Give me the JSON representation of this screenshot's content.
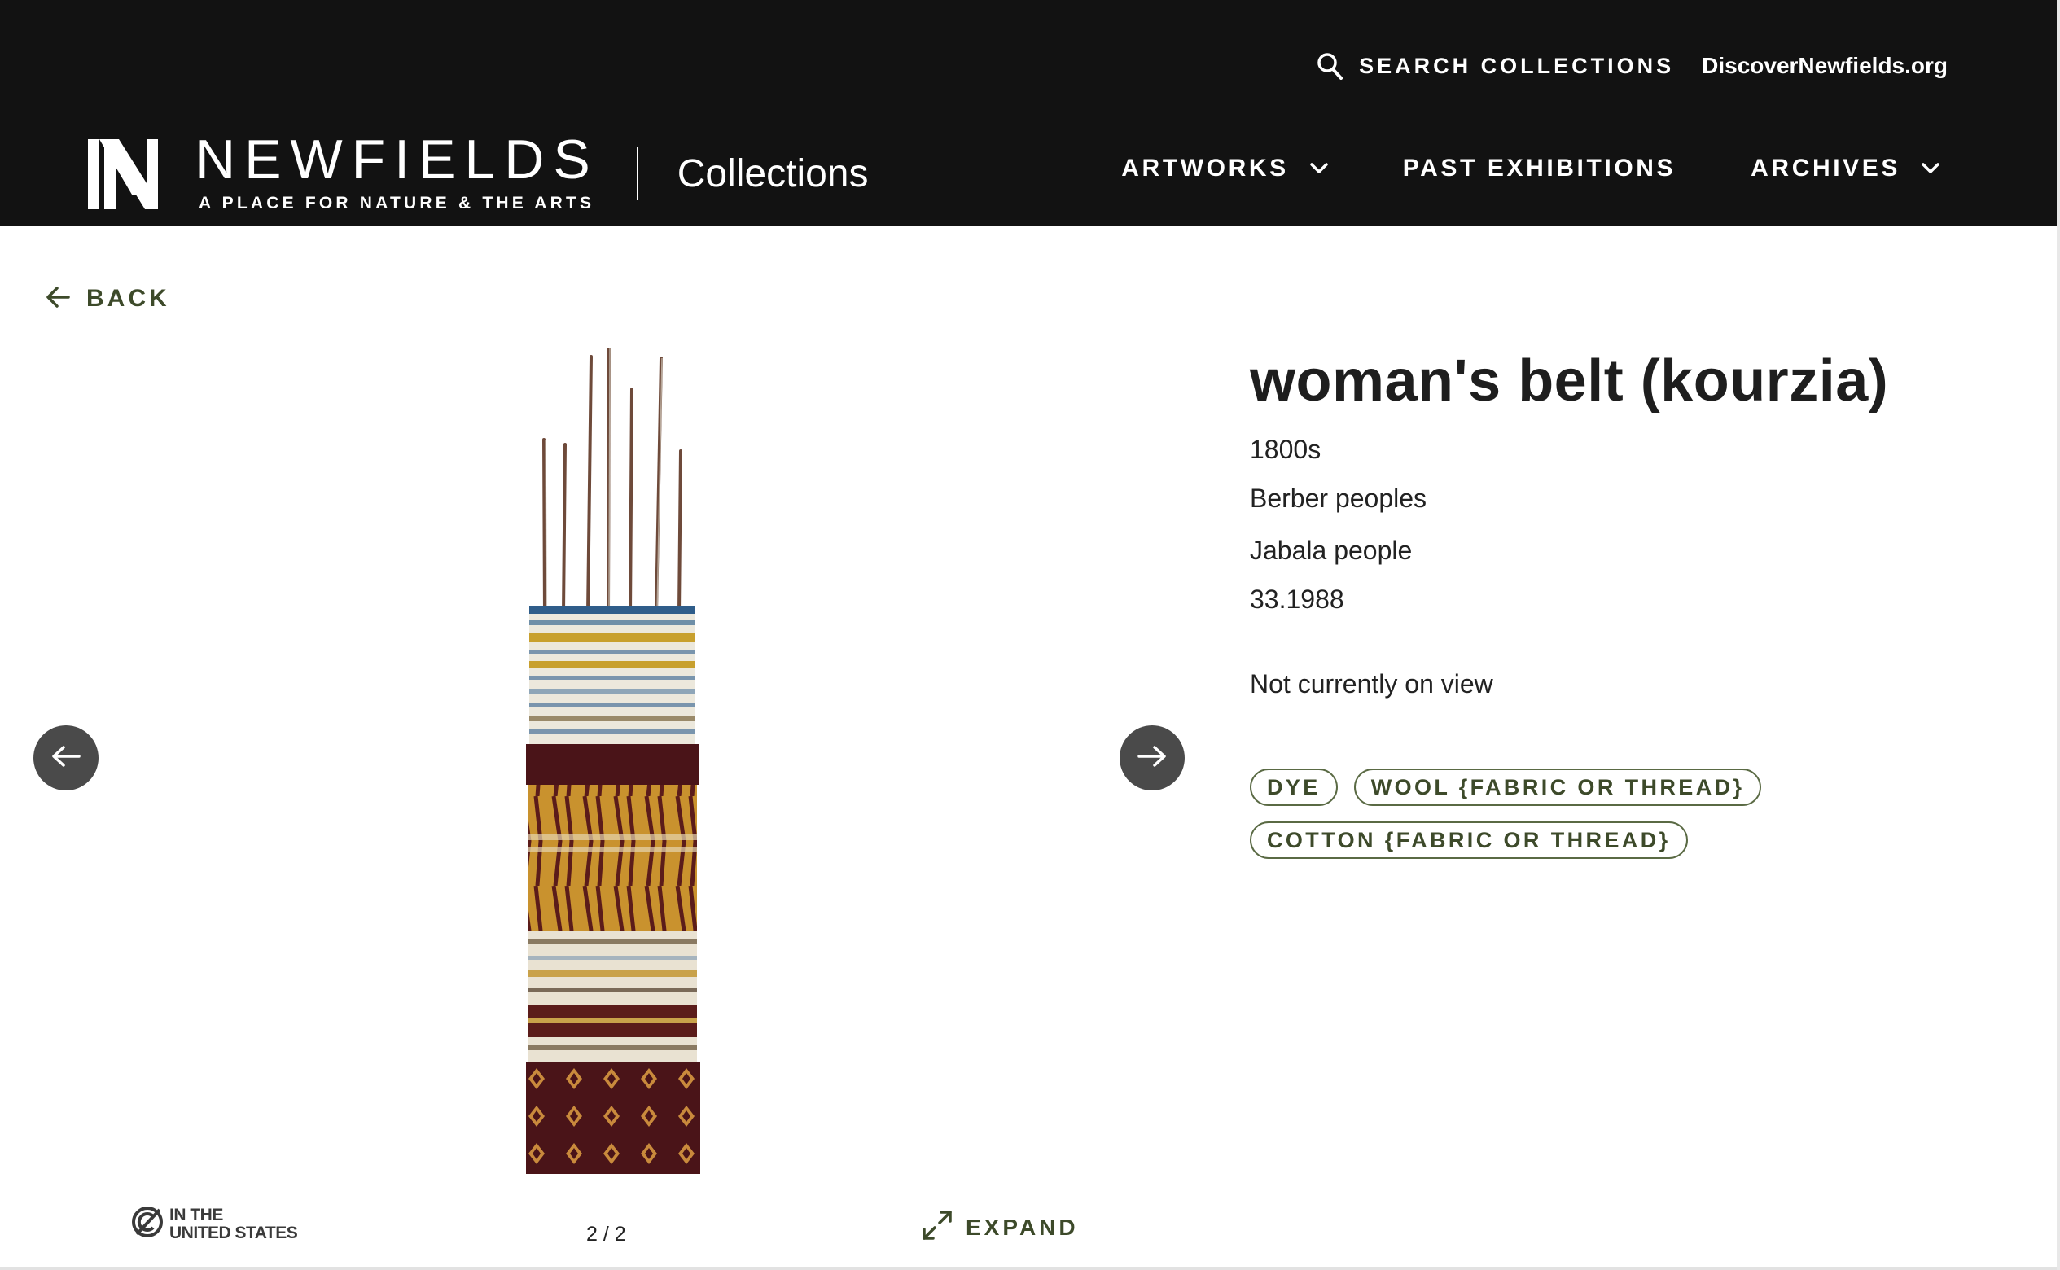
{
  "header": {
    "search_label": "SEARCH COLLECTIONS",
    "discover_link": "DiscoverNewfields.org",
    "brand_name": "NEWFIELDS",
    "brand_tagline": "A PLACE FOR NATURE & THE ARTS",
    "site_title": "Collections",
    "nav": [
      {
        "label": "ARTWORKS",
        "has_dropdown": true
      },
      {
        "label": "PAST EXHIBITIONS",
        "has_dropdown": false
      },
      {
        "label": "ARCHIVES",
        "has_dropdown": true
      }
    ]
  },
  "back_label": "BACK",
  "viewer": {
    "counter": "2 / 2",
    "expand_label": "EXPAND",
    "rights_label": "IN THE\nUNITED STATES"
  },
  "artwork": {
    "title": "woman's belt (kourzia)",
    "date": "1800s",
    "culture": "Berber peoples",
    "people": "Jabala people",
    "accession": "33.1988",
    "view_status": "Not currently on view",
    "tags": [
      "DYE",
      "WOOL {FABRIC OR THREAD}",
      "COTTON {FABRIC OR THREAD}"
    ]
  },
  "colors": {
    "header_bg": "#121212",
    "accent_green": "#3d4a2a",
    "nav_button_bg": "#4a4a4a"
  },
  "icons": [
    "search-icon",
    "chevron-down-icon",
    "newfields-logo",
    "arrow-left-icon",
    "arrow-right-icon",
    "expand-icon",
    "rights-icon"
  ]
}
